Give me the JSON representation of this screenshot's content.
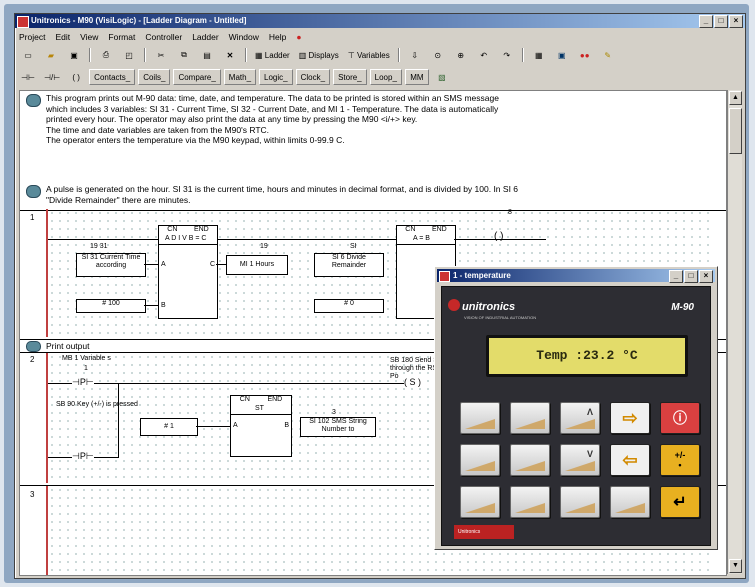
{
  "window": {
    "title": "Unitronics - M90 (VisiLogic) - [Ladder Diagram - Untitled]",
    "btn_min": "_",
    "btn_max": "□",
    "btn_close": "×"
  },
  "menu": [
    "Project",
    "Edit",
    "View",
    "Format",
    "Controller",
    "Ladder",
    "Window",
    "Help"
  ],
  "toolbar2": {
    "contacts": "Contacts_",
    "coils": "Coils_",
    "compare": "Compare_",
    "math": "Math_",
    "logic": "Logic_",
    "clock": "Clock_",
    "store": "Store_",
    "loop": "Loop_",
    "mm": "MM"
  },
  "toolbar1": {
    "ladder": "Ladder",
    "display": "Displays",
    "variables": "Variables"
  },
  "comments": {
    "c1_lines": [
      "This program prints out M-90 data: time, date, and temperature. The data to be printed is stored within an SMS message",
      "which includes 3 variables: SI 31 - Current Time, SI 32 - Current Date, and MI 1 - Temperature. The data is automatically",
      "printed every hour. The operator may also print the data at any time by pressing the M90 <i/+> key.",
      "The time and date variables are taken from the M90's RTC.",
      "The operator enters the temperature via the M90 keypad, within limits 0-99.9 C."
    ],
    "c2_lines": [
      "A pulse is generated on the hour. SI 31 is the current time, hours and minutes in decimal format, and is divided by 100. In SI 6",
      "\"Divide Remainder\" there are minutes."
    ]
  },
  "rung1": {
    "num": "1",
    "fb_title_left": "CN",
    "fb_title_right": "END",
    "fb_name": "A D I V B = C",
    "src_label": "SI 31 Current Time according",
    "src_tag": "19 31",
    "const_label": "# 100",
    "out1_tag": "19",
    "out1_label": "MI 1 Hours",
    "out2_tag": "SI",
    "out2_label": "SI 6 Divide Remainder",
    "const2_label": "# 0",
    "cmp_title_left": "CN",
    "cmp_title_right": "END",
    "cmp_name": "A = B",
    "coil_tag": "8",
    "pin_a": "A",
    "pin_b": "B",
    "pin_c": "C"
  },
  "section2": "Print output",
  "rung2": {
    "num": "2",
    "in1_label": "MB 1 Variable s",
    "in1_tag": "1",
    "in2_label": "SB 90 Key (+/-) is pressed",
    "fb_title_left": "CN",
    "fb_title_right": "END",
    "fb_name": "ST",
    "const_label": "# 1",
    "out_tag": "3",
    "out_label": "SI 102 SMS String Number to",
    "coil_label": "SB 180 Send String through the RS232 Po",
    "pin_a": "A",
    "pin_b": "B"
  },
  "rung3": {
    "num": "3"
  },
  "panel": {
    "title": "1 - temperature",
    "brand": "unitronics",
    "brand_sub": "VISION OF INDUSTRIAL AUTOMATION",
    "model": "M-90",
    "lcd": "Temp :23.2 °C",
    "footer": "Unitronics"
  }
}
